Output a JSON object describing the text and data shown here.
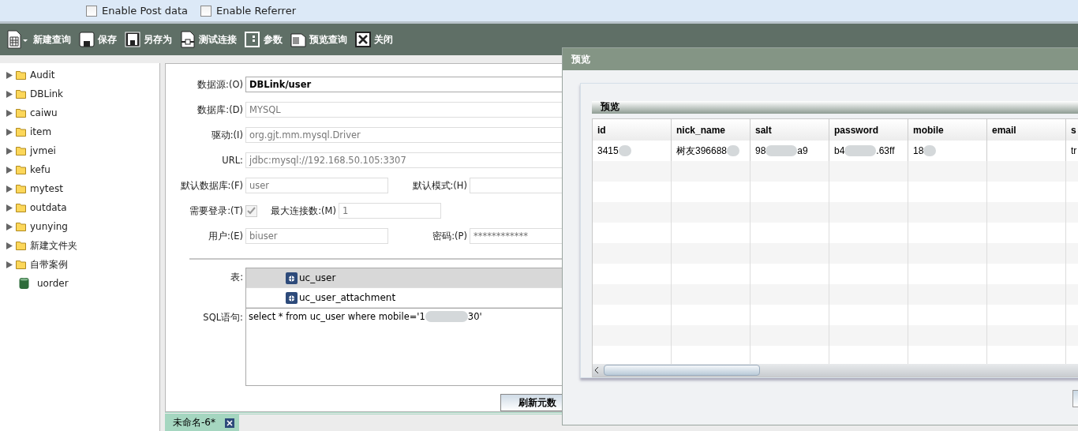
{
  "top_options": [
    {
      "label": "Enable Post data",
      "checked": false
    },
    {
      "label": "Enable Referrer",
      "checked": false
    }
  ],
  "toolbar": [
    {
      "label": "新建查询",
      "kind": "new"
    },
    {
      "label": "保存",
      "kind": "save"
    },
    {
      "label": "另存为",
      "kind": "saveas"
    },
    {
      "label": "测试连接",
      "kind": "test"
    },
    {
      "label": "参数",
      "kind": "params"
    },
    {
      "label": "预览查询",
      "kind": "preview"
    },
    {
      "label": "关闭",
      "kind": "close"
    }
  ],
  "tree": [
    {
      "label": "Audit",
      "kind": "folder"
    },
    {
      "label": "DBLink",
      "kind": "folder"
    },
    {
      "label": "caiwu",
      "kind": "folder"
    },
    {
      "label": "item",
      "kind": "folder"
    },
    {
      "label": "jvmei",
      "kind": "folder"
    },
    {
      "label": "kefu",
      "kind": "folder"
    },
    {
      "label": "mytest",
      "kind": "folder"
    },
    {
      "label": "outdata",
      "kind": "folder"
    },
    {
      "label": "yunying",
      "kind": "folder"
    },
    {
      "label": "新建文件夹",
      "kind": "folder"
    },
    {
      "label": "自带案例",
      "kind": "folder"
    },
    {
      "label": "uorder",
      "kind": "database"
    }
  ],
  "form": {
    "rows": [
      [
        {
          "label": "数据源:(O)",
          "value": "DBLink/user",
          "kind": "bold",
          "disabled": false
        }
      ],
      [
        {
          "label": "数据库:(D)",
          "value": "MYSQL",
          "kind": "text",
          "disabled": true
        }
      ],
      [
        {
          "label": "驱动:(I)",
          "value": "org.gjt.mm.mysql.Driver",
          "kind": "text",
          "disabled": true
        }
      ],
      [
        {
          "label": "URL:",
          "value": "jdbc:mysql://192.168.50.105:3307",
          "kind": "text",
          "disabled": true
        }
      ],
      [
        {
          "label": "默认数据库:(F)",
          "value": "user",
          "kind": "text",
          "disabled": true
        },
        {
          "label": "默认模式:(H)",
          "kind": "text",
          "disabled": true
        }
      ],
      [
        {
          "label": "需要登录:(T)",
          "kind": "checkbox",
          "checked": true,
          "disabled": true
        },
        {
          "label": "最大连接数:(M)",
          "value": "1",
          "kind": "text",
          "disabled": true
        }
      ],
      [
        {
          "label": "用户:(E)",
          "value": "biuser",
          "kind": "text",
          "disabled": true
        },
        {
          "label": "密码:(P)",
          "value": "************",
          "kind": "text",
          "disabled": true
        }
      ]
    ],
    "tables_label": "表:",
    "tables": [
      {
        "name": "uc_user",
        "selected": true
      },
      {
        "name": "uc_user_attachment",
        "selected": false
      }
    ],
    "sql_label": "SQL语句:",
    "sql_parts": [
      "select * from uc_user where mobile='1",
      "30'"
    ],
    "refresh_button": "刷新元数"
  },
  "tabs": [
    {
      "label": "未命名-6*",
      "selected": true
    }
  ],
  "dialog": {
    "title": "预览",
    "section": "预览",
    "columns": [
      "id",
      "nick_name",
      "salt",
      "password",
      "mobile",
      "email",
      "s"
    ],
    "rows": [
      [
        {
          "parts": [
            "3415"
          ],
          "trailing_redaction": true
        },
        {
          "parts": [
            "树友396688"
          ],
          "trailing_redaction": true
        },
        {
          "parts": [
            "98",
            "a9"
          ],
          "trailing_redaction": false
        },
        {
          "parts": [
            "b4",
            ".63ff"
          ],
          "trailing_redaction": false
        },
        {
          "parts": [
            "18"
          ],
          "trailing_redaction": true
        },
        {
          "trailing_redaction": false
        },
        {
          "parts": [
            "tr"
          ],
          "trailing_redaction": false
        }
      ]
    ]
  }
}
